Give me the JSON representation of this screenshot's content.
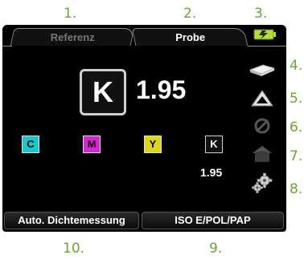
{
  "callouts": [
    "1.",
    "2.",
    "3.",
    "4.",
    "5.",
    "6.",
    "7.",
    "8.",
    "9.",
    "10."
  ],
  "tabs": {
    "reference": "Referenz",
    "sample": "Probe"
  },
  "main": {
    "channel": "K",
    "value": "1.95"
  },
  "channels": [
    {
      "letter": "C",
      "color": "#19c9c9"
    },
    {
      "letter": "M",
      "color": "#d726d0"
    },
    {
      "letter": "Y",
      "color": "#dcd617"
    },
    {
      "letter": "K",
      "color": "#111111",
      "value": "1.95"
    }
  ],
  "side_icons": [
    "battery-charging-icon",
    "paper-stack-icon",
    "triangle-icon",
    "no-filter-icon",
    "house-icon",
    "gear-icon"
  ],
  "buttons": {
    "auto": "Auto. Dichtemessung",
    "standard": "ISO E/POL/PAP"
  },
  "colors": {
    "callout": "#6aa62d",
    "battery": "#b5e02a"
  }
}
